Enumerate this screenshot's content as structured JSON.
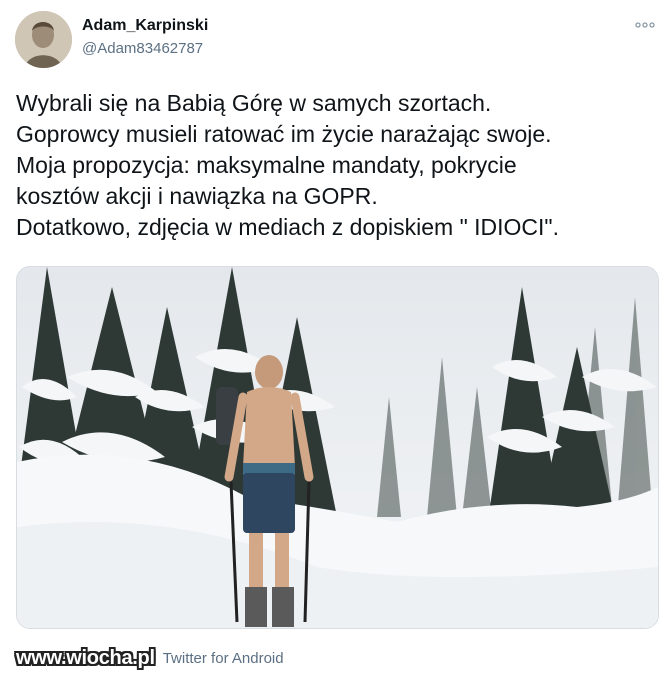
{
  "author": {
    "name": "Adam_Karpinski",
    "handle": "@Adam83462787",
    "avatar": "avatar"
  },
  "tweet": {
    "lines": [
      "Wybrali się na Babią Górę w samych szortach.",
      "Goprowcy musieli ratować im życie narażając swoje.",
      "Moja propozycja: maksymalne mandaty, pokrycie",
      "kosztów akcji i nawiązka na GOPR.",
      "Dotatkowo, zdjęcia w mediach z dopiskiem \" IDIOCI\"."
    ],
    "source": "Twitter for Android"
  },
  "watermark": "www.wiocha.pl",
  "icons": {
    "more": "more-options-icon"
  },
  "colors": {
    "text": "#0f1419",
    "secondary": "#5b7083",
    "background": "#ffffff"
  }
}
